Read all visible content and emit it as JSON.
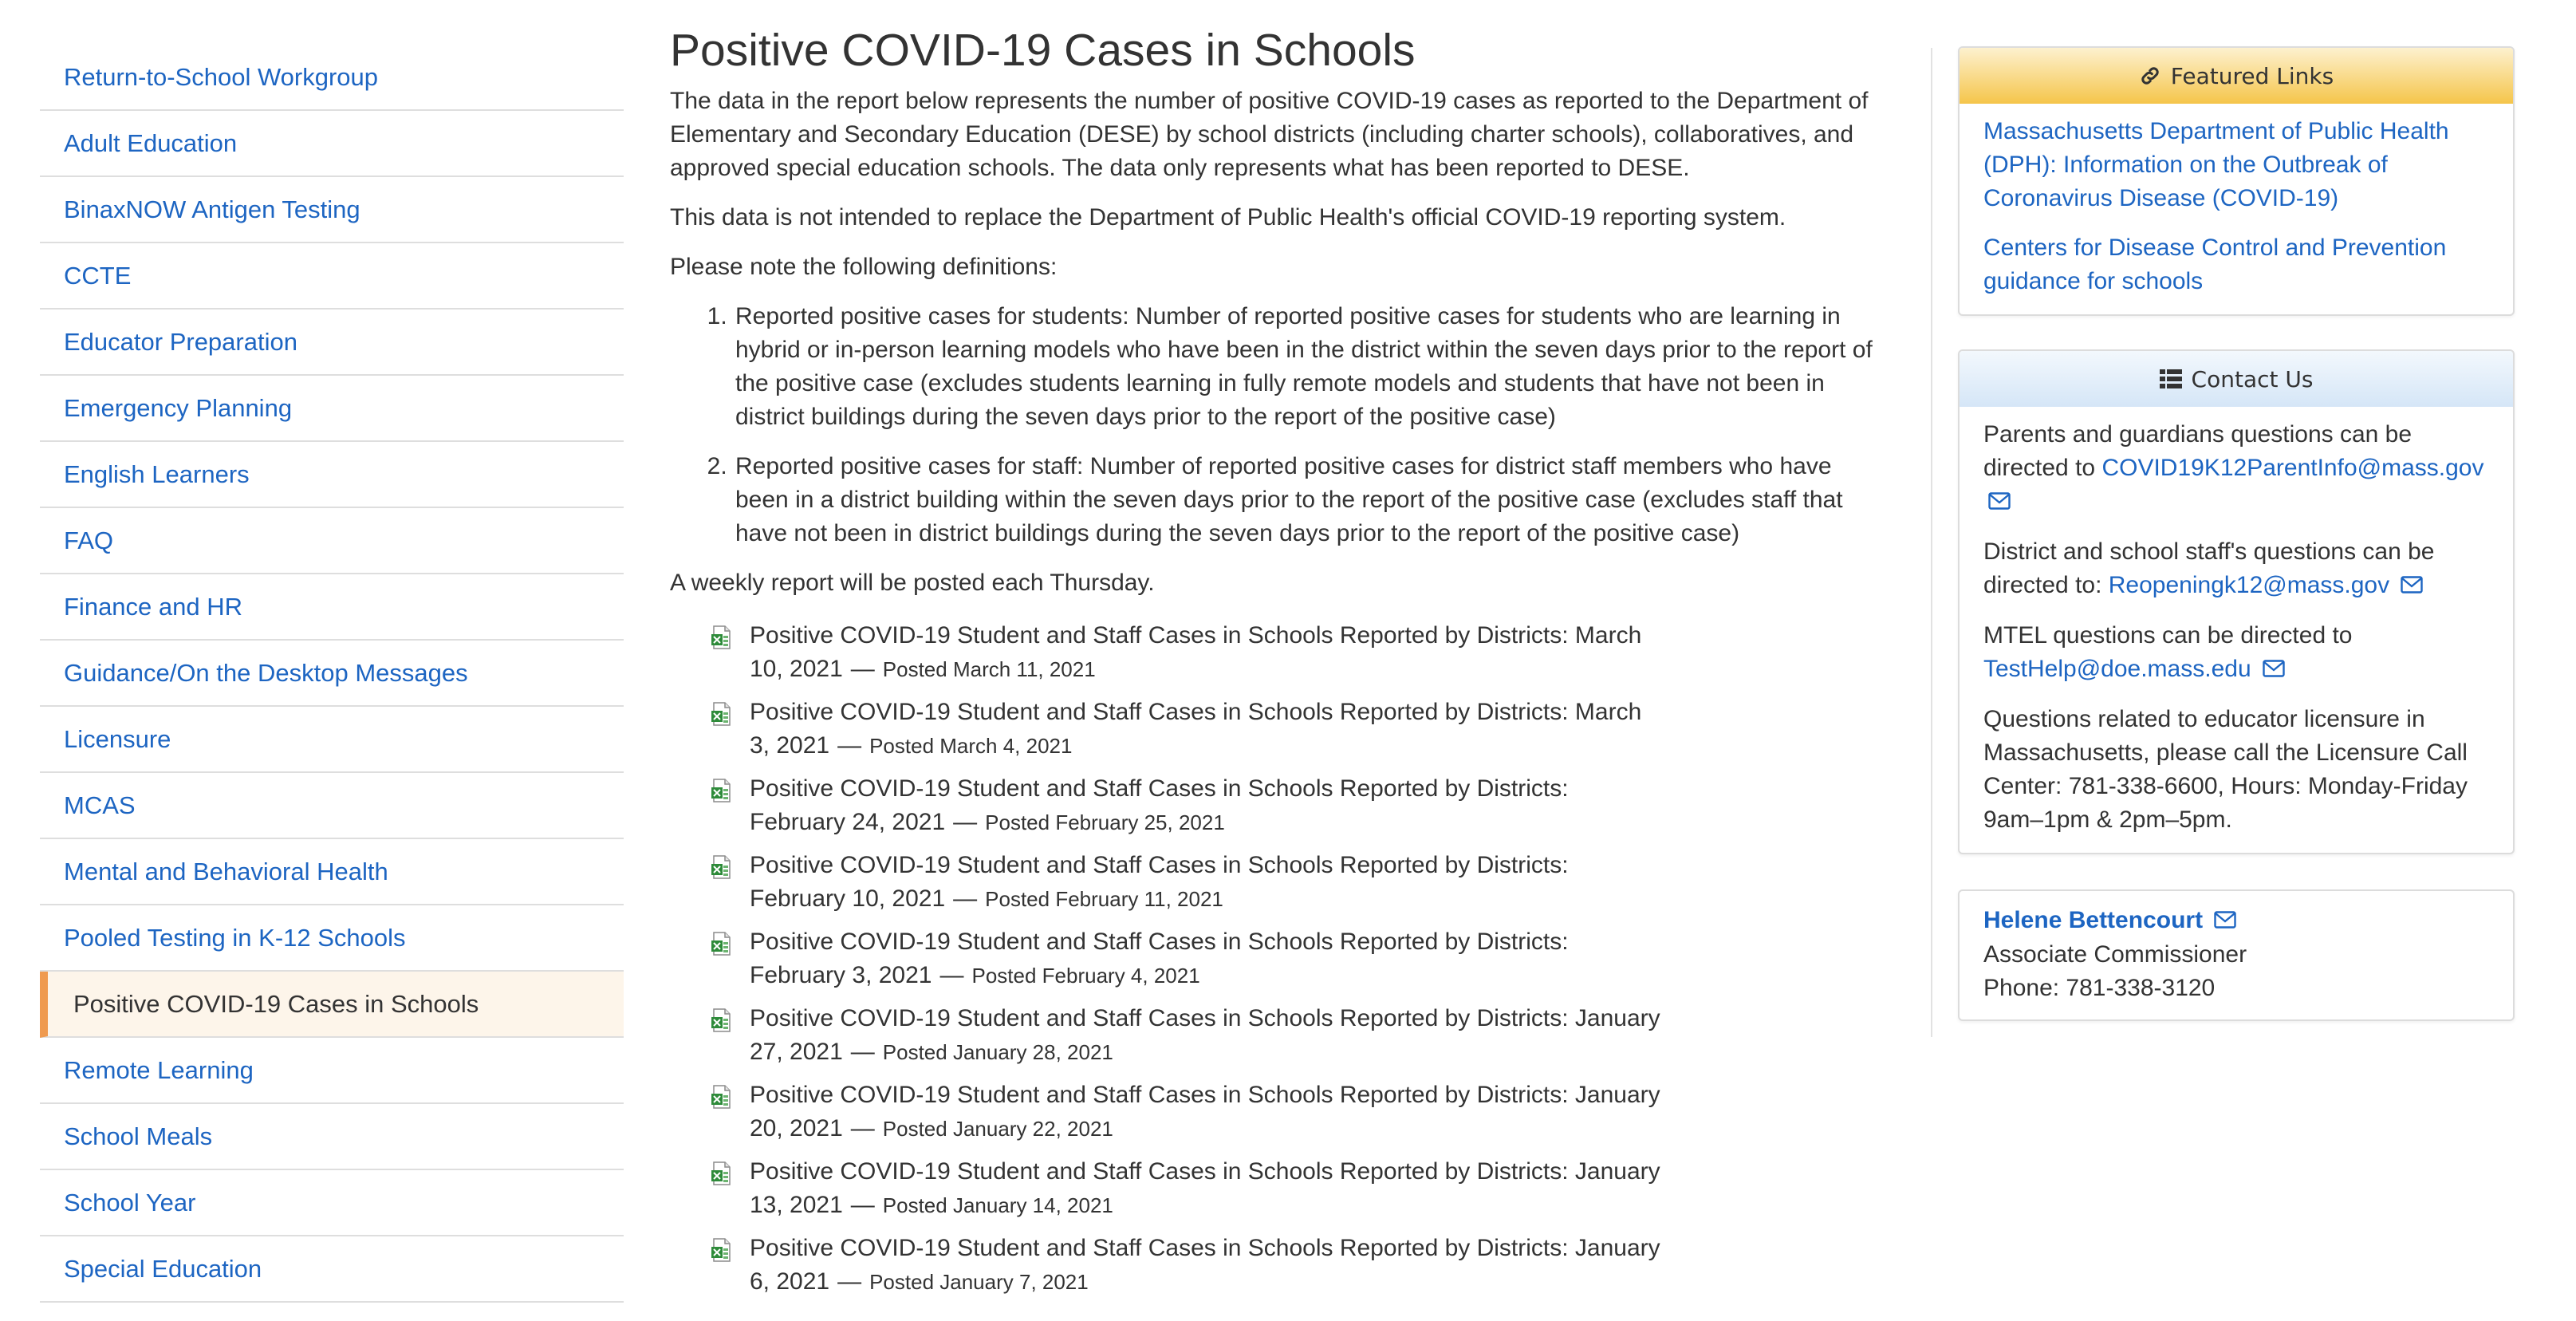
{
  "sidebar": {
    "items": [
      {
        "label": "Return-to-School Workgroup",
        "active": false
      },
      {
        "label": "Adult Education",
        "active": false
      },
      {
        "label": "BinaxNOW Antigen Testing",
        "active": false
      },
      {
        "label": "CCTE",
        "active": false
      },
      {
        "label": "Educator Preparation",
        "active": false
      },
      {
        "label": "Emergency Planning",
        "active": false
      },
      {
        "label": "English Learners",
        "active": false
      },
      {
        "label": "FAQ",
        "active": false
      },
      {
        "label": "Finance and HR",
        "active": false
      },
      {
        "label": "Guidance/On the Desktop Messages",
        "active": false
      },
      {
        "label": "Licensure",
        "active": false
      },
      {
        "label": "MCAS",
        "active": false
      },
      {
        "label": "Mental and Behavioral Health",
        "active": false
      },
      {
        "label": "Pooled Testing in K-12 Schools",
        "active": false
      },
      {
        "label": "Positive COVID-19 Cases in Schools",
        "active": true
      },
      {
        "label": "Remote Learning",
        "active": false
      },
      {
        "label": "School Meals",
        "active": false
      },
      {
        "label": "School Year",
        "active": false
      },
      {
        "label": "Special Education",
        "active": false
      }
    ]
  },
  "main": {
    "title": "Positive COVID-19 Cases in Schools",
    "intro": "The data in the report below represents the number of positive COVID-19 cases as reported to the Department of Elementary and Secondary Education (DESE) by school districts (including charter schools), collaboratives, and approved special education schools. The data only represents what has been reported to DESE.",
    "disclaimer": "This data is not intended to replace the Department of Public Health's official COVID-19 reporting system.",
    "definitions_intro": "Please note the following definitions:",
    "definitions": [
      "Reported positive cases for students: Number of reported positive cases for students who are learning in hybrid or in-person learning models who have been in the district within the seven days prior to the report of the positive case (excludes students learning in fully remote models and students that have not been in district buildings during the seven days prior to the report of the positive case)",
      "Reported positive cases for staff: Number of reported positive cases for district staff members who have been in a district building within the seven days prior to the report of the positive case (excludes staff that have not been in district buildings during the seven days prior to the report of the positive case)"
    ],
    "weekly_note": "A weekly report will be posted each Thursday.",
    "dash": "—",
    "reports": [
      {
        "title": "Positive COVID-19 Student and Staff Cases in Schools Reported by Districts: March 10, 2021",
        "posted": "Posted March 11, 2021"
      },
      {
        "title": "Positive COVID-19 Student and Staff Cases in Schools Reported by Districts: March 3, 2021",
        "posted": "Posted March 4, 2021"
      },
      {
        "title": "Positive COVID-19 Student and Staff Cases in Schools Reported by Districts: February 24, 2021",
        "posted": "Posted February 25, 2021"
      },
      {
        "title": "Positive COVID-19 Student and Staff Cases in Schools Reported by Districts: February 10, 2021",
        "posted": "Posted February 11, 2021"
      },
      {
        "title": "Positive COVID-19 Student and Staff Cases in Schools Reported by Districts: February 3, 2021",
        "posted": "Posted February 4, 2021"
      },
      {
        "title": "Positive COVID-19 Student and Staff Cases in Schools Reported by Districts: January 27, 2021",
        "posted": "Posted January 28, 2021"
      },
      {
        "title": "Positive COVID-19 Student and Staff Cases in Schools Reported by Districts: January 20, 2021",
        "posted": "Posted January 22, 2021"
      },
      {
        "title": "Positive COVID-19 Student and Staff Cases in Schools Reported by Districts: January 13, 2021",
        "posted": "Posted January 14, 2021"
      },
      {
        "title": "Positive COVID-19 Student and Staff Cases in Schools Reported by Districts: January 6, 2021",
        "posted": "Posted January 7, 2021"
      }
    ]
  },
  "featured_links": {
    "title": "Featured Links",
    "icon": "link-icon",
    "header_color": "#f5c54a",
    "links": [
      "Massachusetts Department of Public Health (DPH): Information on the Outbreak of Coronavirus Disease (COVID-19)",
      "Centers for Disease Control and Prevention guidance for schools"
    ]
  },
  "contact": {
    "title": "Contact Us",
    "icon": "list-icon",
    "parents_text": "Parents and guardians questions can be directed to",
    "parents_email": "COVID19K12ParentInfo@mass.gov",
    "staff_text": "District and school staff's questions can be directed to:",
    "staff_email": "Reopeningk12@mass.gov",
    "mtel_text": "MTEL questions can be directed to",
    "mtel_email": "TestHelp@doe.mass.edu",
    "licensure_text": "Questions related to educator licensure in Massachusetts, please call the Licensure Call Center: 781-338-6600, Hours: Monday-Friday 9am–1pm & 2pm–5pm."
  },
  "person": {
    "name": "Helene Bettencourt",
    "role": "Associate Commissioner",
    "phone": "Phone: 781-338-3120"
  },
  "colors": {
    "link": "#1d65c2",
    "active_bg": "#fdf5ea",
    "active_border": "#ef9a4f",
    "text": "#333333"
  }
}
